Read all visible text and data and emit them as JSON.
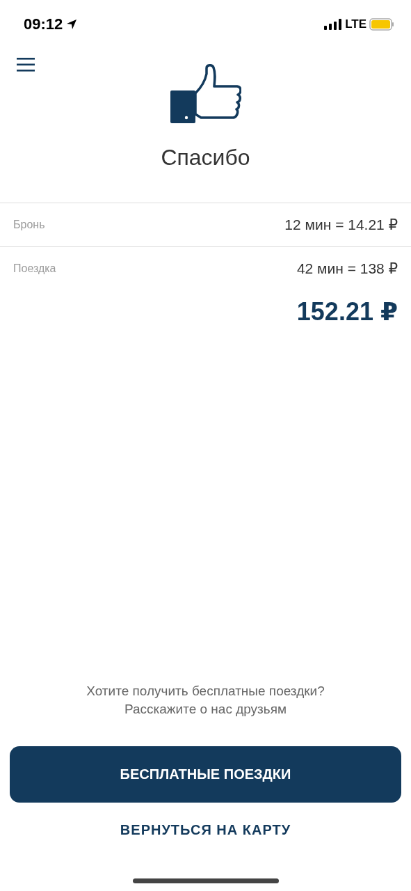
{
  "status_bar": {
    "time": "09:12",
    "network": "LTE"
  },
  "title": "Спасибо",
  "rows": [
    {
      "label": "Бронь",
      "value": "12 мин = 14.21 ₽"
    },
    {
      "label": "Поездка",
      "value": "42 мин = 138 ₽"
    }
  ],
  "total": "152.21 ₽",
  "promo": [
    "Хотите получить бесплатные поездки?",
    "Расскажите о нас друзьям"
  ],
  "primary_button": "БЕСПЛАТНЫЕ ПОЕЗДКИ",
  "secondary_button": "ВЕРНУТЬСЯ НА КАРТУ"
}
